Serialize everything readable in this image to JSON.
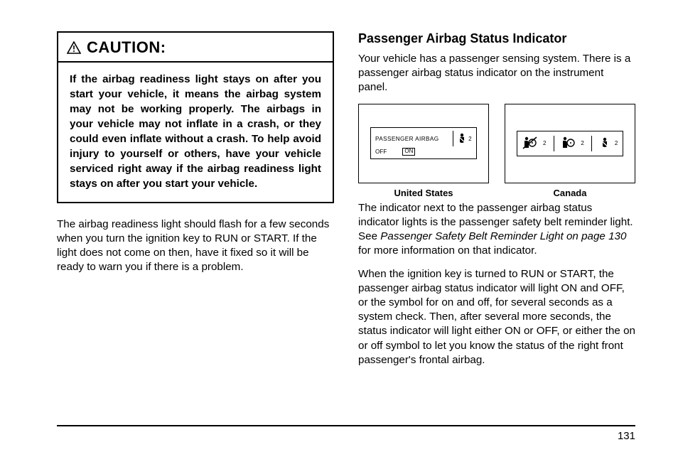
{
  "left": {
    "caution_title": "CAUTION:",
    "caution_body": "If the airbag readiness light stays on after you start your vehicle, it means the airbag system may not be working properly. The airbags in your vehicle may not inflate in a crash, or they could even inflate without a crash. To help avoid injury to yourself or others, have your vehicle serviced right away if the airbag readiness light stays on after you start your vehicle.",
    "para1": "The airbag readiness light should flash for a few seconds when you turn the ignition key to RUN or START. If the light does not come on then, have it fixed so it will be ready to warn you if there is a problem."
  },
  "right": {
    "heading": "Passenger Airbag Status Indicator",
    "para1": "Your vehicle has a passenger sensing system. There is a passenger airbag status indicator on the instrument panel.",
    "fig_us_caption": "United States",
    "fig_ca_caption": "Canada",
    "panel_us_label": "PASSENGER AIRBAG",
    "panel_us_off": "OFF",
    "panel_us_on": "ON",
    "panel_belt_num": "2",
    "para2_a": "The indicator next to the passenger airbag status indicator lights is the passenger safety belt reminder light. See ",
    "para2_ref": "Passenger Safety Belt Reminder Light on page 130",
    "para2_b": " for more information on that indicator.",
    "para3": "When the ignition key is turned to RUN or START, the passenger airbag status indicator will light ON and OFF, or the symbol for on and off, for several seconds as a system check. Then, after several more seconds, the status indicator will light either ON or OFF, or either the on or off symbol to let you know the status of the right front passenger's frontal airbag."
  },
  "page_number": "131"
}
